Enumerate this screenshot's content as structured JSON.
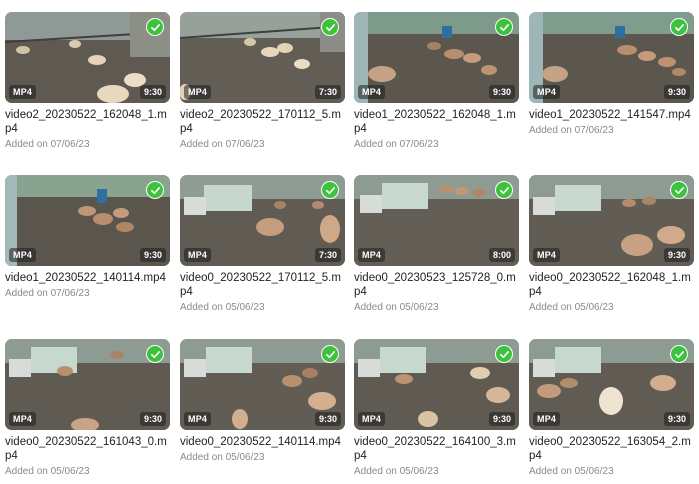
{
  "ui": {
    "type_badge": "MP4",
    "added_prefix": "Added on",
    "accent": "#3cc23c"
  },
  "videos": [
    {
      "name": "video2_20230522_162048_1.mp4",
      "duration": "9:30",
      "added": "Added on 07/06/23",
      "selected": true
    },
    {
      "name": "video2_20230522_170112_5.mp4",
      "duration": "7:30",
      "added": "Added on 07/06/23",
      "selected": true
    },
    {
      "name": "video1_20230522_162048_1.mp4",
      "duration": "9:30",
      "added": "Added on 07/06/23",
      "selected": true
    },
    {
      "name": "video1_20230522_141547.mp4",
      "duration": "9:30",
      "added": "Added on 07/06/23",
      "selected": true
    },
    {
      "name": "video1_20230522_140114.mp4",
      "duration": "9:30",
      "added": "Added on 07/06/23",
      "selected": true
    },
    {
      "name": "video0_20230522_170112_5.mp4",
      "duration": "7:30",
      "added": "Added on 05/06/23",
      "selected": true
    },
    {
      "name": "video0_20230523_125728_0.mp4",
      "duration": "8:00",
      "added": "Added on 05/06/23",
      "selected": true
    },
    {
      "name": "video0_20230522_162048_1.mp4",
      "duration": "9:30",
      "added": "Added on 05/06/23",
      "selected": true
    },
    {
      "name": "video0_20230522_161043_0.mp4",
      "duration": "9:30",
      "added": "Added on 05/06/23",
      "selected": true
    },
    {
      "name": "video0_20230522_140114.mp4",
      "duration": "9:30",
      "added": "Added on 05/06/23",
      "selected": true
    },
    {
      "name": "video0_20230522_164100_3.mp4",
      "duration": "9:30",
      "added": "Added on 05/06/23",
      "selected": true
    },
    {
      "name": "video0_20230522_163054_2.mp4",
      "duration": "9:30",
      "added": "Added on 05/06/23",
      "selected": true
    }
  ]
}
